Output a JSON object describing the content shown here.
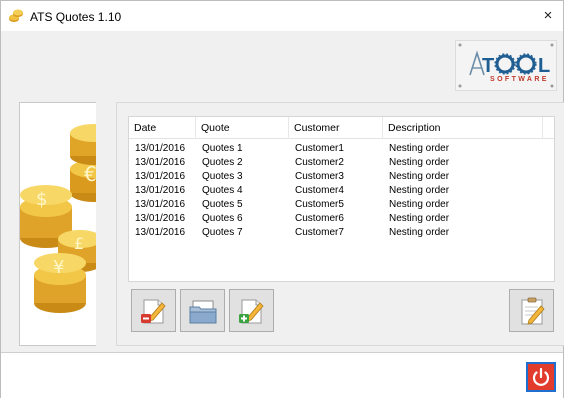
{
  "window": {
    "title": "ATS Quotes 1.10",
    "close_glyph": "×"
  },
  "logo": {
    "name": "ATOOL",
    "sub": "SOFTWARE"
  },
  "table": {
    "headers": [
      "Date",
      "Quote",
      "Customer",
      "Description"
    ],
    "rows": [
      [
        "13/01/2016",
        "Quotes 1",
        "Customer1",
        "Nesting order"
      ],
      [
        "13/01/2016",
        "Quotes 2",
        "Customer2",
        "Nesting order"
      ],
      [
        "13/01/2016",
        "Quotes 3",
        "Customer3",
        "Nesting order"
      ],
      [
        "13/01/2016",
        "Quotes 4",
        "Customer4",
        "Nesting order"
      ],
      [
        "13/01/2016",
        "Quotes 5",
        "Customer5",
        "Nesting order"
      ],
      [
        "13/01/2016",
        "Quotes 6",
        "Customer6",
        "Nesting order"
      ],
      [
        "13/01/2016",
        "Quotes 7",
        "Customer7",
        "Nesting order"
      ]
    ]
  },
  "toolbar": {
    "buttons": [
      "delete-quote-icon",
      "open-folder-icon",
      "add-quote-icon",
      "edit-report-icon"
    ]
  },
  "footer": {
    "exit_icon": "power-icon"
  },
  "colors": {
    "accent_blue": "#1e6fd0",
    "exit_red": "#e23c2c",
    "coin_gold": "#e2a92c"
  }
}
